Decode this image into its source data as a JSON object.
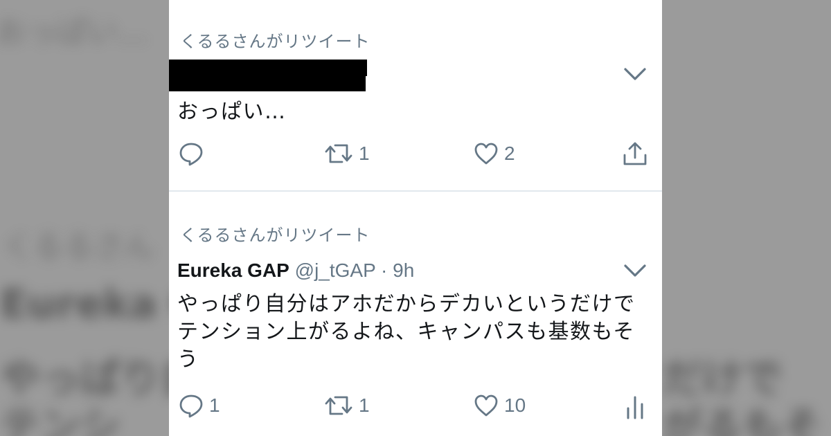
{
  "background": {
    "left_blur_glyphs": [
      "おっぱい…",
      "くるるさん",
      "Eureka G",
      "やっぱり自",
      "テンシ"
    ],
    "right_blur_glyphs": [
      "だけで",
      "がるもそ"
    ]
  },
  "colors": {
    "text": "#14171a",
    "secondary": "#657786",
    "divider": "#e1e8ed"
  },
  "tweets": [
    {
      "retweet_label": "くるるさんがリツイート",
      "text_lines": [
        "おっぱい…"
      ],
      "reply_count": "",
      "retweet_count": "1",
      "like_count": "2",
      "last_icon": "share-icon"
    },
    {
      "retweet_label": "くるるさんがリツイート",
      "author_name": "Eureka GAP",
      "author_meta": " @j_tGAP · 9h",
      "text_lines": [
        "やっぱり自分はアホだからデカいというだけで",
        "テンション上がるよね、キャンパスも基数もそ",
        "う"
      ],
      "reply_count": "1",
      "retweet_count": "1",
      "like_count": "10",
      "last_icon": "analytics-icon"
    }
  ]
}
